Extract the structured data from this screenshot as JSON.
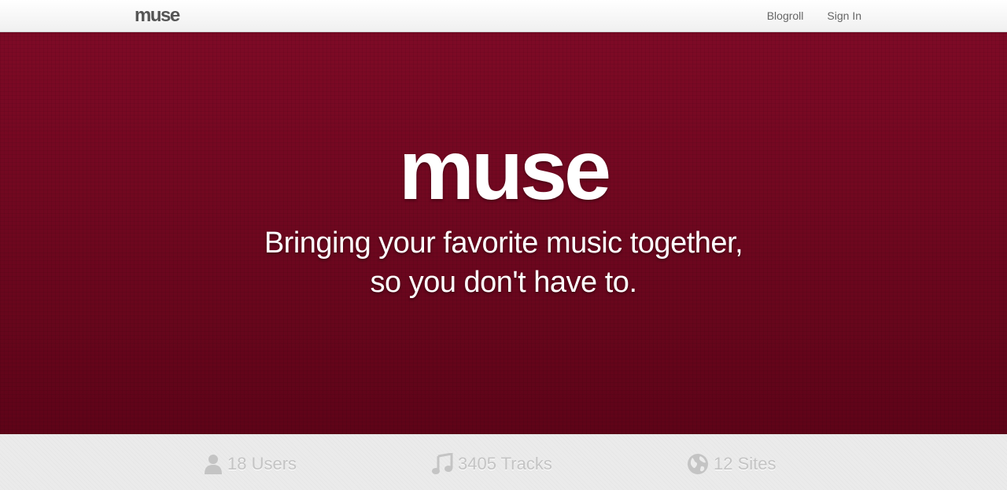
{
  "navbar": {
    "brand": "muse",
    "links": [
      "Blogroll",
      "Sign In"
    ]
  },
  "hero": {
    "title": "muse",
    "tagline_line1": "Bringing your favorite music together,",
    "tagline_line2": "so you don't have to."
  },
  "stats": {
    "users": {
      "icon": "user-icon",
      "label": "18 Users"
    },
    "tracks": {
      "icon": "music-note-icon",
      "label": "3405 Tracks"
    },
    "sites": {
      "icon": "globe-icon",
      "label": "12 Sites"
    }
  },
  "colors": {
    "hero_background": "#7a0a24",
    "stat_text": "#c4c4c4",
    "nav_text": "#666666"
  }
}
